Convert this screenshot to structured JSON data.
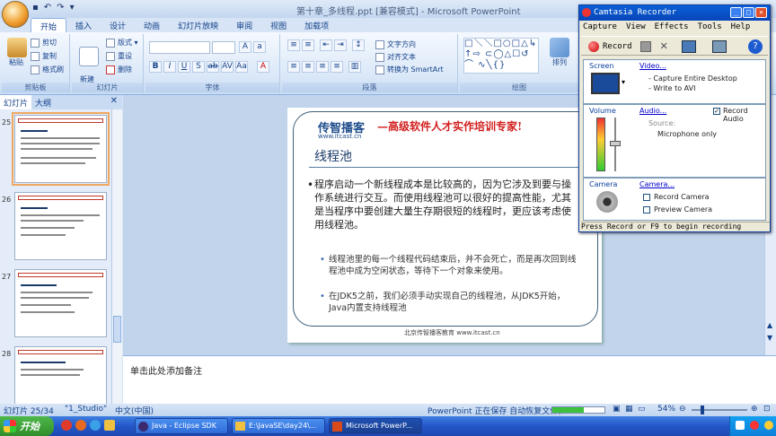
{
  "window": {
    "title": "第十章_多线程.ppt [兼容模式] - Microsoft PowerPoint"
  },
  "ribbon_tabs": [
    "开始",
    "插入",
    "设计",
    "动画",
    "幻灯片放映",
    "审阅",
    "视图",
    "加载项"
  ],
  "clipboard": {
    "paste": "粘贴",
    "cut": "剪切",
    "copy": "复制",
    "format_painter": "格式刷",
    "label": "剪贴板"
  },
  "slides_group": {
    "new_slide": "新建\n幻灯片",
    "layout": "版式",
    "reset": "重设",
    "delete": "删除",
    "label": "幻灯片"
  },
  "font_group": {
    "label": "字体"
  },
  "paragraph_group": {
    "text_direction": "文字方向",
    "align_text": "对齐文本",
    "smartart": "转换为 SmartArt",
    "label": "段落"
  },
  "drawing_group": {
    "arrange": "排列",
    "label": "绘图"
  },
  "left_panel": {
    "tab_slides": "幻灯片",
    "tab_outline": "大纲",
    "slide_numbers": [
      "25",
      "26",
      "27",
      "28"
    ]
  },
  "slide": {
    "logo_name": "传智播客",
    "logo_url": "www.itcast.cn",
    "slogan": "—高级软件人才实作培训专家!",
    "title": "线程池",
    "bullet": "程序启动一个新线程成本是比较高的，因为它涉及到要与操作系统进行交互。而使用线程池可以很好的提高性能，尤其是当程序中要创建大量生存期很短的线程时，更应该考虑使用线程池。",
    "sub_bullets": [
      "线程池里的每一个线程代码结束后，并不会死亡，而是再次回到线程池中成为空闲状态，等待下一个对象来使用。",
      "在JDK5之前，我们必须手动实现自己的线程池，从JDK5开始，Java内置支持线程池"
    ],
    "footer": "北京传智播客教育 www.itcast.cn"
  },
  "notes": {
    "placeholder": "单击此处添加备注"
  },
  "status": {
    "slide_info": "幻灯片 25/34",
    "theme": "\"1_Studio\"",
    "language": "中文(中国)",
    "autosave": "PowerPoint 正在保存 自动恢复文件。",
    "zoom": "54%"
  },
  "taskbar": {
    "start": "开始",
    "items": [
      "Java - Eclipse SDK",
      "E:\\JavaSE\\day24\\...",
      "Microsoft PowerP..."
    ]
  },
  "camtasia": {
    "title": "Camtasia Recorder",
    "menu": [
      "Capture",
      "View",
      "Effects",
      "Tools",
      "Help"
    ],
    "record": "Record",
    "screen_label": "Screen",
    "video_link": "Video...",
    "video_lines": [
      "- Capture Entire Desktop",
      "- Write to AVI"
    ],
    "volume_label": "Volume",
    "audio_link": "Audio...",
    "record_audio": "Record Audio",
    "source_label": "Source:",
    "source_value": "Microphone only",
    "camera_label": "Camera",
    "camera_link": "Camera...",
    "record_camera": "Record Camera",
    "preview_camera": "Preview Camera",
    "status": "Press Record or F9 to begin recording"
  },
  "colors": {
    "accent": "#15428b",
    "slogan_red": "#d21f1f",
    "logo_blue": "#1f4e8c",
    "taskbar_blue": "#2456c8",
    "start_green": "#3a9a35"
  }
}
